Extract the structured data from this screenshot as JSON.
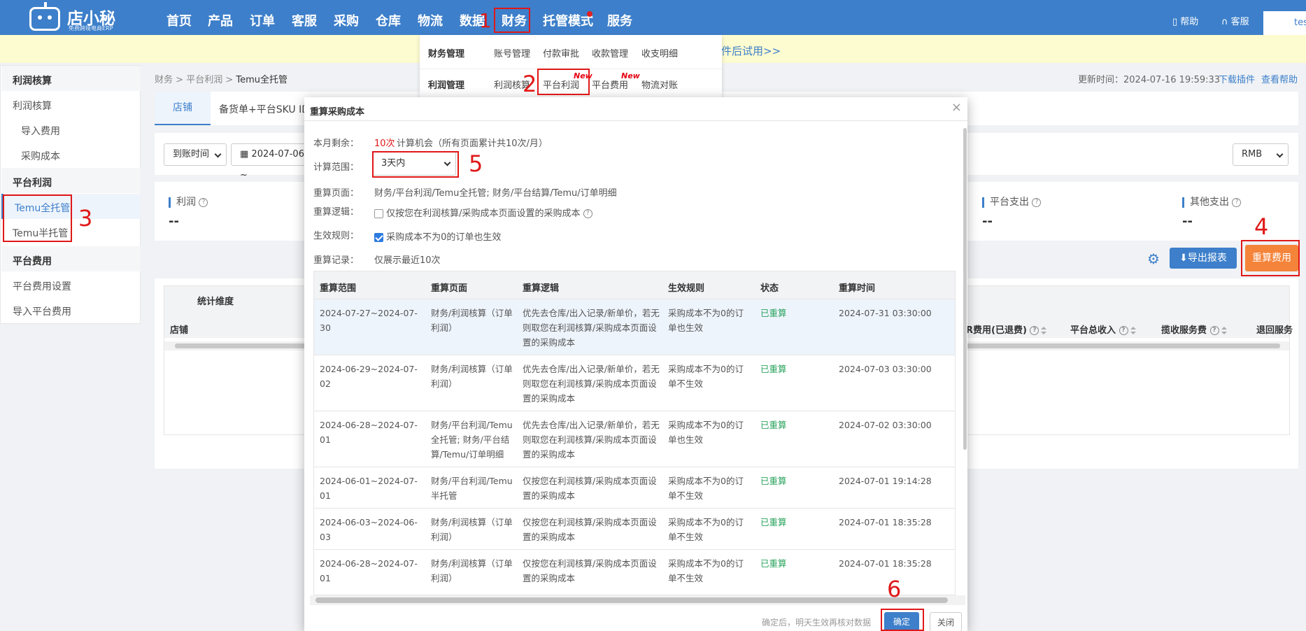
{
  "brand": {
    "name": "店小秘",
    "tagline": "免费跨境电商ERP"
  },
  "topnav": [
    {
      "label": "首页"
    },
    {
      "label": "产品"
    },
    {
      "label": "订单"
    },
    {
      "label": "客服"
    },
    {
      "label": "采购"
    },
    {
      "label": "仓库"
    },
    {
      "label": "物流"
    },
    {
      "label": "数据"
    },
    {
      "label": "财务"
    },
    {
      "label": "托管模式"
    },
    {
      "label": "服务"
    }
  ],
  "toplinks": {
    "help": "帮助",
    "service": "客服",
    "user": "test"
  },
  "notice_text": "件后试用>>",
  "dropdown": {
    "row1": {
      "head": "财务管理",
      "links": [
        "账号管理",
        "付款审批",
        "收款管理",
        "收支明细"
      ]
    },
    "row2": {
      "head": "利润管理",
      "links": [
        "利润核算",
        "平台利润",
        "平台费用",
        "物流对账"
      ]
    },
    "new_badge": "New"
  },
  "sidebar": {
    "groups": [
      {
        "title": "利润核算",
        "items": [
          "利润核算",
          "导入费用",
          "采购成本"
        ]
      },
      {
        "title": "平台利润",
        "items": [
          "Temu全托管",
          "Temu半托管"
        ]
      },
      {
        "title": "平台费用",
        "items": [
          "平台费用设置",
          "导入平台费用"
        ]
      }
    ]
  },
  "breadcrumb": {
    "a": "财务",
    "b": "平台利润",
    "c": "Temu全托管",
    "sep": ">"
  },
  "update_info": {
    "text": "更新时间：2024-07-16 19:59:33",
    "download": "下载插件",
    "help": "查看帮助"
  },
  "tabs": {
    "shop": "店铺",
    "other": "备货单+平台SKU ID"
  },
  "filters": {
    "time_type": "到账时间",
    "date": "2024-07-06 ~",
    "currency": "RMB"
  },
  "stats": {
    "profit": "利润",
    "platform_out": "平台支出",
    "other_out": "其他支出",
    "empty": "--"
  },
  "actions": {
    "export": "导出报表",
    "recalc": "重算费用"
  },
  "table": {
    "dim": "统计维度",
    "shop": "店铺",
    "cols": [
      "R费用(已退费)",
      "平台总收入",
      "揽收服务费",
      "退回服务"
    ]
  },
  "modal": {
    "title": "重算采购成本",
    "close": "×",
    "remain_label": "本月剩余：",
    "remain_count": "10次",
    "remain_desc": "计算机会（所有页面累计共10次/月）",
    "range_label": "计算范围：",
    "range_value": "3天内",
    "page_label": "重算页面：",
    "page_value": "财务/平台利润/Temu全托管; 财务/平台结算/Temu/订单明细",
    "logic_label": "重算逻辑：",
    "logic_option": "仅按您在利润核算/采购成本页面设置的采购成本",
    "rule_label": "生效规则：",
    "rule_option": "采购成本不为0的订单也生效",
    "record_label": "重算记录：",
    "record_value": "仅展示最近10次",
    "headers": [
      "重算范围",
      "重算页面",
      "重算逻辑",
      "生效规则",
      "状态",
      "重算时间"
    ],
    "rows": [
      {
        "range": "2024-07-27~2024-07-30",
        "page": "财务/利润核算（订单利润）",
        "logic": "优先去仓库/出入记录/新单价，若无则取您在利润核算/采购成本页面设置的采购成本",
        "rule": "采购成本不为0的订单也生效",
        "status": "已重算",
        "time": "2024-07-31 03:30:00"
      },
      {
        "range": "2024-06-29~2024-07-02",
        "page": "财务/利润核算（订单利润）",
        "logic": "优先去仓库/出入记录/新单价，若无则取您在利润核算/采购成本页面设置的采购成本",
        "rule": "采购成本不为0的订单不生效",
        "status": "已重算",
        "time": "2024-07-03 03:30:00"
      },
      {
        "range": "2024-06-28~2024-07-01",
        "page": "财务/平台利润/Temu全托管; 财务/平台结算/Temu/订单明细",
        "logic": "优先去仓库/出入记录/新单价，若无则取您在利润核算/采购成本页面设置的采购成本",
        "rule": "采购成本不为0的订单也生效",
        "status": "已重算",
        "time": "2024-07-02 03:30:00"
      },
      {
        "range": "2024-06-01~2024-07-01",
        "page": "财务/平台利润/Temu半托管",
        "logic": "仅按您在利润核算/采购成本页面设置的采购成本",
        "rule": "采购成本不为0的订单不生效",
        "status": "已重算",
        "time": "2024-07-01 19:14:28"
      },
      {
        "range": "2024-06-03~2024-06-03",
        "page": "财务/利润核算（订单利润）",
        "logic": "仅按您在利润核算/采购成本页面设置的采购成本",
        "rule": "采购成本不为0的订单不生效",
        "status": "已重算",
        "time": "2024-07-01 18:35:28"
      },
      {
        "range": "2024-06-28~2024-07-01",
        "page": "财务/利润核算（订单利润）",
        "logic": "仅按您在利润核算/采购成本页面设置的采购成本",
        "rule": "采购成本不为0的订单不生效",
        "status": "已重算",
        "time": "2024-07-01 18:35:28"
      }
    ],
    "footer_note": "确定后，明天生效再核对数据",
    "ok": "确定",
    "cancel": "关闭"
  },
  "annotations": [
    "1",
    "2",
    "3",
    "4",
    "5",
    "6"
  ],
  "colors": {
    "primary": "#3d7fca",
    "accent": "#f5843b",
    "annotation": "#e01818",
    "success": "#27a35b",
    "notice_bg": "#fdfbd0"
  }
}
